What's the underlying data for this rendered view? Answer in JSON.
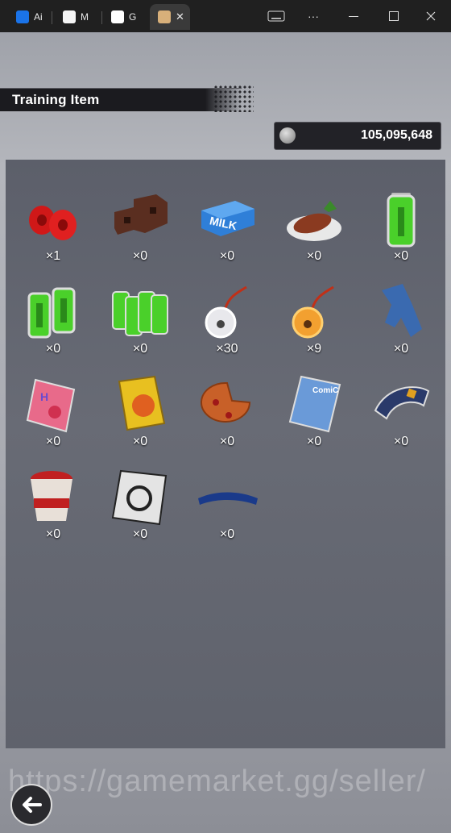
{
  "browser": {
    "tabs": [
      {
        "label": "Ai",
        "color": "#1a73e8"
      },
      {
        "label": "M",
        "color": "#f5f5f5"
      },
      {
        "label": "G",
        "color": "#ffffff"
      },
      {
        "label": "",
        "color": "#d8b07a"
      }
    ],
    "close_glyph": "✕",
    "more_glyph": "···"
  },
  "header": {
    "title": "Training Item"
  },
  "currency": {
    "amount": "105,095,648",
    "icon": "coin-icon"
  },
  "items": [
    {
      "name": "red-weights",
      "count": "×1"
    },
    {
      "name": "brick-blocks",
      "count": "×0"
    },
    {
      "name": "milk-carton",
      "count": "×0"
    },
    {
      "name": "grilled-fish",
      "count": "×0"
    },
    {
      "name": "battery-single",
      "count": "×0"
    },
    {
      "name": "battery-double",
      "count": "×0"
    },
    {
      "name": "battery-pack",
      "count": "×0"
    },
    {
      "name": "silver-bell",
      "count": "×30"
    },
    {
      "name": "gold-bell",
      "count": "×9"
    },
    {
      "name": "jeans",
      "count": "×0"
    },
    {
      "name": "magazine-pink",
      "count": "×0"
    },
    {
      "name": "magazine-yellow",
      "count": "×0"
    },
    {
      "name": "pizza",
      "count": "×0"
    },
    {
      "name": "comic-book",
      "count": "×0"
    },
    {
      "name": "wristband",
      "count": "×0"
    },
    {
      "name": "cup-noodles",
      "count": "×0"
    },
    {
      "name": "emblem-card",
      "count": "×0"
    },
    {
      "name": "headband",
      "count": "×0"
    }
  ],
  "watermark": "https://gamemarket.gg/seller/",
  "back_icon": "back-arrow-icon"
}
